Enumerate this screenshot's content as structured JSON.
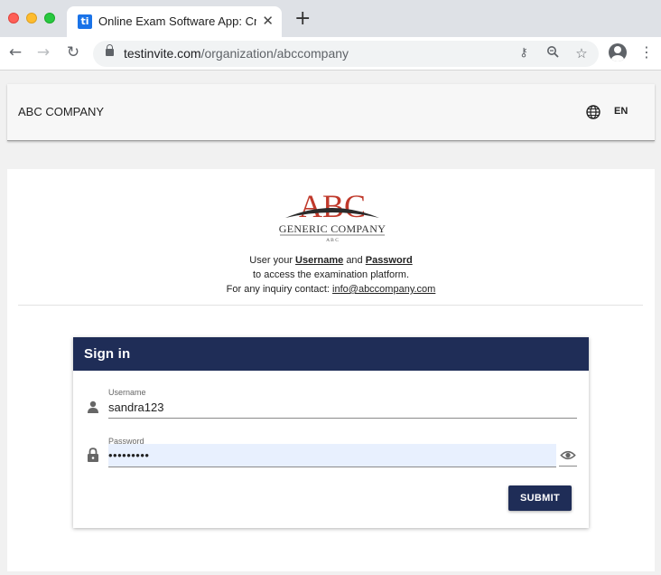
{
  "browser": {
    "tab_title": "Online Exam Software App: Cre",
    "favicon_text": "ti",
    "url_domain": "testinvite.com",
    "url_path": "/organization/abccompany"
  },
  "header": {
    "org_name": "ABC COMPANY",
    "language": "EN"
  },
  "logo": {
    "brand": "ABC",
    "company": "GENERIC COMPANY",
    "sub": "A B C"
  },
  "intro": {
    "line1_prefix": "User your",
    "username_word": "Username",
    "and_word": "and",
    "password_word": "Password",
    "line2": "to access the examination platform.",
    "line3_prefix": "For any inquiry contact:",
    "email": "info@abccompany.com"
  },
  "signin": {
    "title": "Sign in",
    "username_label": "Username",
    "username_value": "sandra123",
    "password_label": "Password",
    "password_value": "•••••••••",
    "submit_label": "SUBMIT"
  },
  "colors": {
    "primary": "#1f2d57",
    "autofill": "#e8f0fe"
  }
}
